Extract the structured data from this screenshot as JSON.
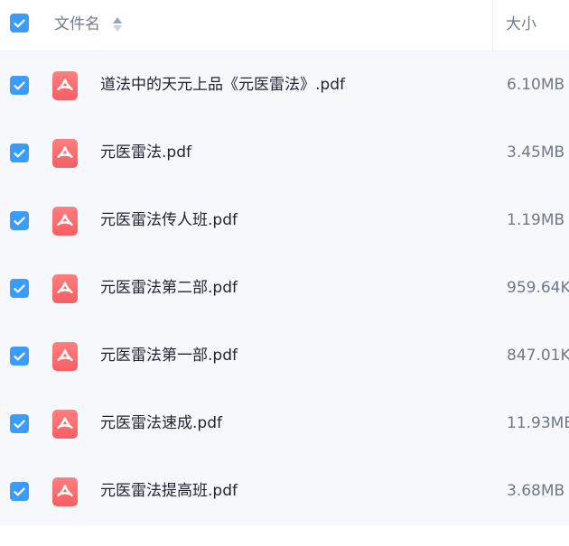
{
  "header": {
    "name_label": "文件名",
    "size_label": "大小",
    "select_all_checked": true
  },
  "colors": {
    "accent": "#3b9cff",
    "pdf_icon": "#f45f64",
    "row_background": "#f7f8fc"
  },
  "files": [
    {
      "name": "道法中的天元上品《元医雷法》.pdf",
      "size": "6.10MB",
      "checked": true,
      "icon": "pdf-icon"
    },
    {
      "name": "元医雷法.pdf",
      "size": "3.45MB",
      "checked": true,
      "icon": "pdf-icon"
    },
    {
      "name": "元医雷法传人班.pdf",
      "size": "1.19MB",
      "checked": true,
      "icon": "pdf-icon"
    },
    {
      "name": "元医雷法第二部.pdf",
      "size": "959.64K",
      "checked": true,
      "icon": "pdf-icon"
    },
    {
      "name": "元医雷法第一部.pdf",
      "size": "847.01K",
      "checked": true,
      "icon": "pdf-icon"
    },
    {
      "name": "元医雷法速成.pdf",
      "size": "11.93MB",
      "checked": true,
      "icon": "pdf-icon"
    },
    {
      "name": "元医雷法提高班.pdf",
      "size": "3.68MB",
      "checked": true,
      "icon": "pdf-icon"
    }
  ]
}
